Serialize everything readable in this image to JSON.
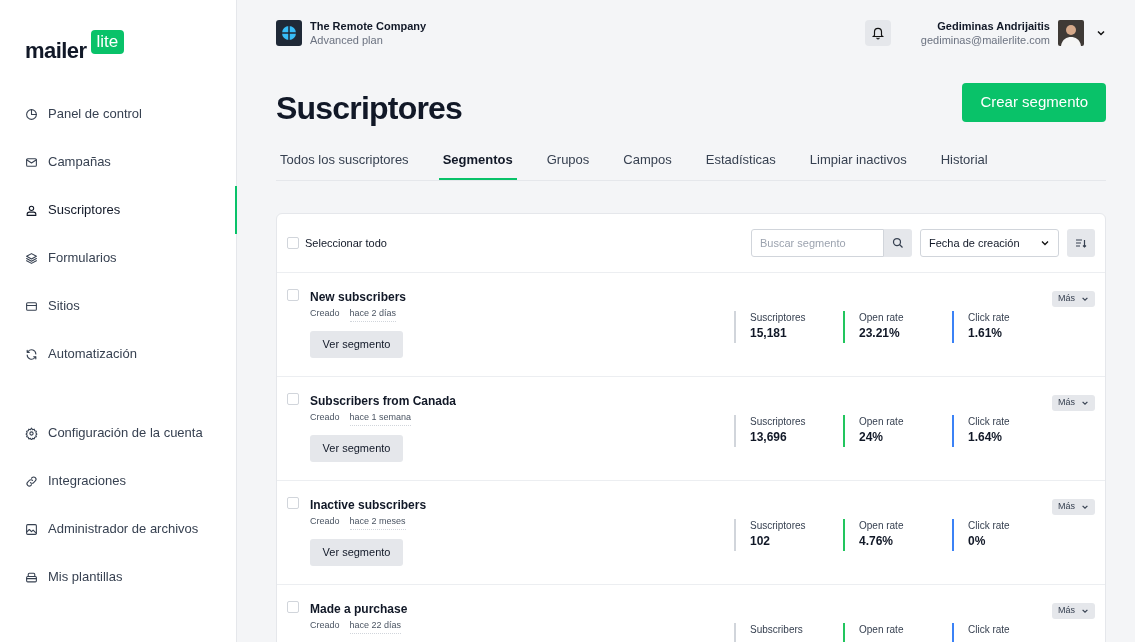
{
  "logo": {
    "word": "mailer",
    "badge": "lite"
  },
  "sidebar": {
    "items": [
      {
        "label": "Panel de control",
        "selected": false
      },
      {
        "label": "Campañas",
        "selected": false
      },
      {
        "label": "Suscriptores",
        "selected": true
      },
      {
        "label": "Formularios",
        "selected": false
      },
      {
        "label": "Sitios",
        "selected": false
      },
      {
        "label": "Automatización",
        "selected": false
      }
    ],
    "bottom_items": [
      {
        "label": "Configuración de la cuenta",
        "selected": false
      },
      {
        "label": "Integraciones",
        "selected": false
      },
      {
        "label": "Administrador de archivos",
        "selected": false
      },
      {
        "label": "Mis plantillas",
        "selected": false
      }
    ]
  },
  "account": {
    "company": "The Remote Company",
    "plan": "Advanced plan",
    "user_name": "Gediminas Andrijaitis",
    "user_email": "gediminas@mailerlite.com"
  },
  "page_title": "Suscriptores",
  "primary_button": "Crear segmento",
  "tabs": [
    {
      "label": "Todos los suscriptores",
      "selected": false
    },
    {
      "label": "Segmentos",
      "selected": true
    },
    {
      "label": "Grupos",
      "selected": false
    },
    {
      "label": "Campos",
      "selected": false
    },
    {
      "label": "Estadísticas",
      "selected": false
    },
    {
      "label": "Limpiar inactivos",
      "selected": false
    },
    {
      "label": "Historial",
      "selected": false
    }
  ],
  "toolbar": {
    "select_all": {
      "label": "Seleccionar todo",
      "checked": false
    },
    "search": {
      "placeholder": "Buscar segmento"
    },
    "sort": {
      "value": "Fecha de creación"
    }
  },
  "segments": [
    {
      "name": "New subscribers",
      "checked": false,
      "created_label": "Creado",
      "created": "hace 2 días",
      "button": "Ver segmento",
      "more": "Más",
      "stats": [
        {
          "label": "Suscriptores",
          "value": "15,181",
          "color": "#d1d5db"
        },
        {
          "label": "Open rate",
          "value": "23.21%",
          "color": "#22c55e"
        },
        {
          "label": "Click rate",
          "value": "1.61%",
          "color": "#3b82f6"
        }
      ]
    },
    {
      "name": "Subscribers from Canada",
      "checked": false,
      "created_label": "Creado",
      "created": "hace 1 semana",
      "button": "Ver segmento",
      "more": "Más",
      "stats": [
        {
          "label": "Suscriptores",
          "value": "13,696",
          "color": "#d1d5db"
        },
        {
          "label": "Open rate",
          "value": "24%",
          "color": "#22c55e"
        },
        {
          "label": "Click rate",
          "value": "1.64%",
          "color": "#3b82f6"
        }
      ]
    },
    {
      "name": "Inactive subscribers",
      "checked": false,
      "created_label": "Creado",
      "created": "hace 2 meses",
      "button": "Ver segmento",
      "more": "Más",
      "stats": [
        {
          "label": "Suscriptores",
          "value": "102",
          "color": "#d1d5db"
        },
        {
          "label": "Open rate",
          "value": "4.76%",
          "color": "#22c55e"
        },
        {
          "label": "Click rate",
          "value": "0%",
          "color": "#3b82f6"
        }
      ]
    },
    {
      "name": "Made a purchase",
      "checked": false,
      "created_label": "Creado",
      "created": "hace 22 días",
      "more": "Más",
      "stats": [
        {
          "label": "Subscribers",
          "color": "#d1d5db"
        },
        {
          "label": "Open rate",
          "color": "#22c55e"
        },
        {
          "label": "Click rate",
          "color": "#3b82f6"
        }
      ]
    }
  ]
}
